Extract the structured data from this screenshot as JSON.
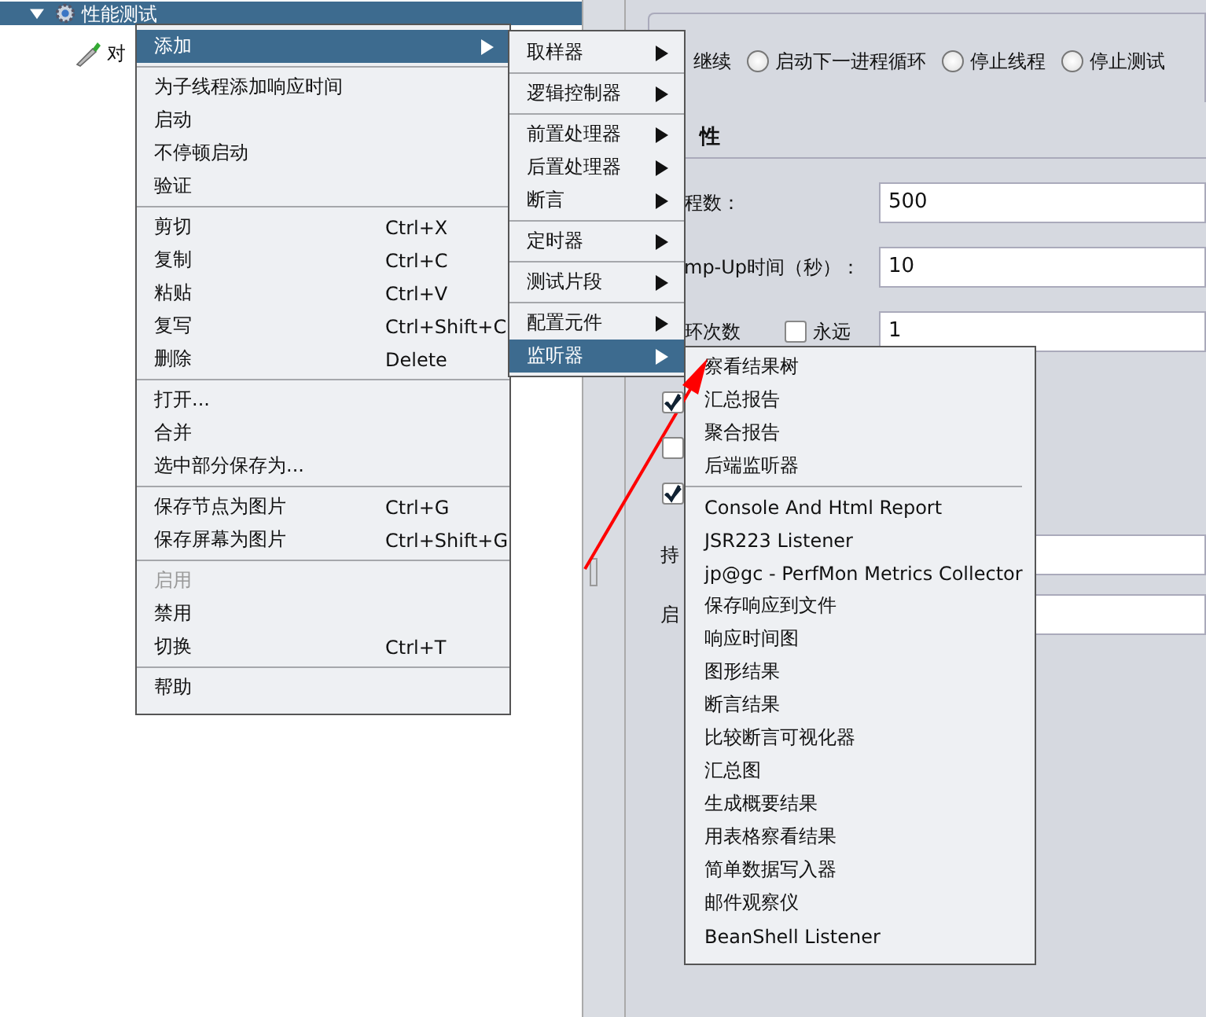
{
  "tree": {
    "items": [
      {
        "label": "性能测试",
        "selected": true,
        "expanded": true,
        "children": [
          {
            "label": "对",
            "selected": false
          }
        ]
      }
    ]
  },
  "error_action": {
    "partial_label": "继续",
    "options": [
      {
        "label": "启动下一进程循环",
        "selected": false
      },
      {
        "label": "停止线程",
        "selected": false
      },
      {
        "label": "停止测试",
        "selected": false
      }
    ]
  },
  "properties": {
    "title": "性",
    "fields": [
      {
        "label": "程数：",
        "value": "500"
      },
      {
        "label": "mp-Up时间（秒）：",
        "value": "10"
      },
      {
        "label": "环次数",
        "value": "1",
        "forever": {
          "label": "永远",
          "checked": false
        }
      }
    ],
    "checkboxes": [
      {
        "checked": true
      },
      {
        "checked": false
      },
      {
        "checked": true
      }
    ],
    "more_fields": [
      {
        "label": "持"
      },
      {
        "label": "启"
      }
    ]
  },
  "context_menu": {
    "groups": [
      [
        {
          "label": "添加",
          "selected": true,
          "submenu": true
        }
      ],
      [
        {
          "label": "为子线程添加响应时间"
        },
        {
          "label": "启动"
        },
        {
          "label": "不停顿启动"
        },
        {
          "label": "验证"
        }
      ],
      [
        {
          "label": "剪切",
          "shortcut": "Ctrl+X"
        },
        {
          "label": "复制",
          "shortcut": "Ctrl+C"
        },
        {
          "label": "粘贴",
          "shortcut": "Ctrl+V"
        },
        {
          "label": "复写",
          "shortcut": "Ctrl+Shift+C"
        },
        {
          "label": "删除",
          "shortcut": "Delete"
        }
      ],
      [
        {
          "label": "打开..."
        },
        {
          "label": "合并"
        },
        {
          "label": "选中部分保存为..."
        }
      ],
      [
        {
          "label": "保存节点为图片",
          "shortcut": "Ctrl+G"
        },
        {
          "label": "保存屏幕为图片",
          "shortcut": "Ctrl+Shift+G"
        }
      ],
      [
        {
          "label": "启用",
          "disabled": true
        },
        {
          "label": "禁用"
        },
        {
          "label": "切换",
          "shortcut": "Ctrl+T"
        }
      ],
      [
        {
          "label": "帮助"
        }
      ]
    ]
  },
  "add_submenu": {
    "groups": [
      [
        {
          "label": "取样器",
          "submenu": true
        }
      ],
      [
        {
          "label": "逻辑控制器",
          "submenu": true
        }
      ],
      [
        {
          "label": "前置处理器",
          "submenu": true
        },
        {
          "label": "后置处理器",
          "submenu": true
        },
        {
          "label": "断言",
          "submenu": true
        }
      ],
      [
        {
          "label": "定时器",
          "submenu": true
        }
      ],
      [
        {
          "label": "测试片段",
          "submenu": true
        }
      ],
      [
        {
          "label": "配置元件",
          "submenu": true
        },
        {
          "label": "监听器",
          "submenu": true,
          "selected": true
        }
      ]
    ]
  },
  "listener_submenu": {
    "groups": [
      [
        {
          "label": "察看结果树"
        },
        {
          "label": "汇总报告"
        },
        {
          "label": "聚合报告"
        },
        {
          "label": "后端监听器"
        }
      ],
      [
        {
          "label": "Console And Html Report"
        },
        {
          "label": "JSR223 Listener"
        },
        {
          "label": "jp@gc - PerfMon Metrics Collector"
        },
        {
          "label": "保存响应到文件"
        },
        {
          "label": "响应时间图"
        },
        {
          "label": "图形结果"
        },
        {
          "label": "断言结果"
        },
        {
          "label": "比较断言可视化器"
        },
        {
          "label": "汇总图"
        },
        {
          "label": "生成概要结果"
        },
        {
          "label": "用表格察看结果"
        },
        {
          "label": "简单数据写入器"
        },
        {
          "label": "邮件观察仪"
        },
        {
          "label": "BeanShell Listener"
        }
      ]
    ]
  }
}
